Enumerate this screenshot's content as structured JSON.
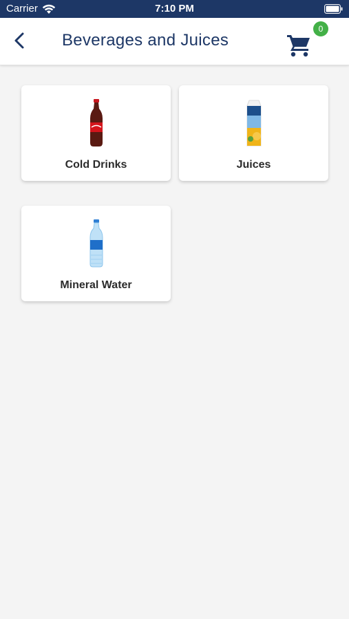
{
  "status_bar": {
    "carrier": "Carrier",
    "time": "7:10 PM"
  },
  "header": {
    "title": "Beverages and Juices",
    "cart_count": "0",
    "back_icon": "chevron-left-icon",
    "cart_icon": "shopping-cart-icon"
  },
  "categories": [
    {
      "label": "Cold Drinks",
      "icon": "cola-bottle"
    },
    {
      "label": "Juices",
      "icon": "juice-carton"
    },
    {
      "label": "Mineral Water",
      "icon": "water-bottle"
    }
  ],
  "colors": {
    "brand": "#1d3766",
    "badge": "#43b047",
    "background": "#f4f4f4"
  }
}
